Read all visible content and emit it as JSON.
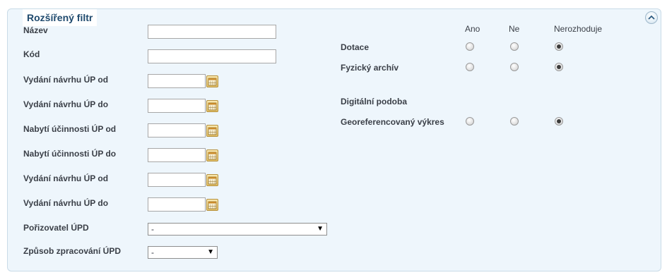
{
  "filter": {
    "title": "Rozšířený filtr",
    "fields": [
      {
        "label": "Název",
        "value": ""
      },
      {
        "label": "Kód",
        "value": ""
      }
    ],
    "date_fields": [
      {
        "label": "Vydání návrhu ÚP od",
        "value": ""
      },
      {
        "label": "Vydání návrhu ÚP do",
        "value": ""
      },
      {
        "label": "Nabytí účinnosti ÚP od",
        "value": ""
      },
      {
        "label": "Nabytí účinnosti ÚP do",
        "value": ""
      },
      {
        "label": "Vydání návrhu ÚP od",
        "value": ""
      },
      {
        "label": "Vydání návrhu ÚP do",
        "value": ""
      }
    ],
    "selects": [
      {
        "label": "Pořizovatel ÚPD",
        "value": "-"
      },
      {
        "label": "Způsob zpracování ÚPD",
        "value": "-"
      }
    ],
    "radio_columns": [
      "Ano",
      "Ne",
      "Nerozhoduje"
    ],
    "radio_rows": [
      {
        "label": "Dotace",
        "selected": "Nerozhoduje"
      },
      {
        "label": "Fyzický archív",
        "selected": "Nerozhoduje"
      },
      {
        "label": "Georeferencovaný výkres",
        "selected": "Nerozhoduje"
      }
    ],
    "section_label": "Digitální podoba"
  },
  "icons": {
    "collapse": "chevron-up-icon",
    "calendar": "calendar-icon",
    "dropdown": "triangle-down-icon"
  },
  "colors": {
    "panel_bg": "#eef6fc",
    "panel_border": "#c9dbe7",
    "title": "#1f4a6e",
    "calendar_accent": "#e5c36a"
  }
}
